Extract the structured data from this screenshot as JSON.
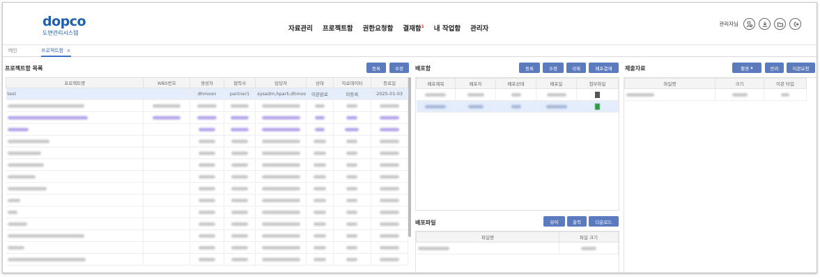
{
  "header": {
    "logo_mark": "dopco",
    "logo_sub": "도면관리시스템",
    "nav": [
      "자료관리",
      "프로젝트함",
      "권한요청함",
      "결재함",
      "내 작업함",
      "관리자"
    ],
    "approval_badge": "1",
    "user_label": "관리자님"
  },
  "tabs": [
    {
      "label": "메인"
    },
    {
      "label": "프로젝트함",
      "close": "×"
    }
  ],
  "projects": {
    "title": "프로젝트함 목록",
    "buttons": {
      "register": "등록",
      "edit": "수정"
    },
    "columns": [
      "프로젝트명",
      "WBS번호",
      "생성자",
      "협력사",
      "담당자",
      "상태",
      "자료데이터",
      "종료일"
    ],
    "selected_row": {
      "name": "test",
      "wbs": "",
      "creator": "dhmoon",
      "partner": "partner1",
      "manager": "sysadm,hpark,dhmoon",
      "status": "이관완료",
      "data": "미등록",
      "end_date": "2025-01-03"
    }
  },
  "distribution": {
    "title": "배포함",
    "buttons": {
      "register": "등록",
      "edit": "수정",
      "delete": "삭제",
      "approve": "배포결재"
    },
    "columns": [
      "배포제목",
      "배포자",
      "배포상태",
      "배포일",
      "첨부파일"
    ]
  },
  "dist_files": {
    "title": "배포파일",
    "buttons": {
      "viewer": "뷰어",
      "print": "출력",
      "download": "다운로드"
    },
    "columns": [
      "파일명",
      "파일 크기"
    ]
  },
  "submissions": {
    "title": "제출자료",
    "buttons": {
      "use": "활용",
      "return": "반려",
      "transfer": "이관요청"
    },
    "columns": [
      "파일명",
      "크기",
      "이관 타입"
    ]
  },
  "colors": {
    "accent": "#1d5fb0",
    "button": "#5c7bbf",
    "selected": "#e4edfb"
  }
}
